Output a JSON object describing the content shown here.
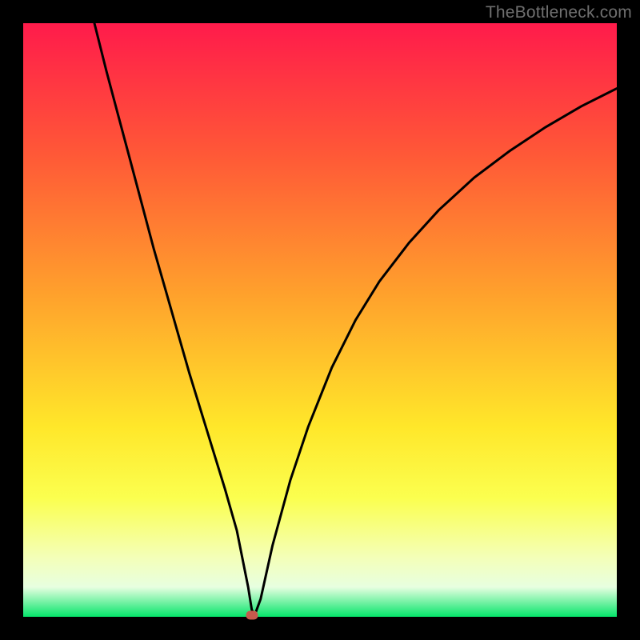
{
  "watermark": "TheBottleneck.com",
  "chart_data": {
    "type": "line",
    "title": "",
    "xlabel": "",
    "ylabel": "",
    "xlim": [
      0,
      100
    ],
    "ylim": [
      0,
      100
    ],
    "grid": false,
    "legend": false,
    "series": [
      {
        "name": "curve",
        "x": [
          12,
          14,
          16,
          18,
          20,
          22,
          24,
          26,
          28,
          30,
          32,
          34,
          36,
          37.9,
          38.5,
          39,
          40,
          42,
          45,
          48,
          52,
          56,
          60,
          65,
          70,
          76,
          82,
          88,
          94,
          100
        ],
        "values": [
          100,
          92,
          84.5,
          77,
          69.5,
          62,
          55,
          48,
          41,
          34.5,
          28,
          21.5,
          14.5,
          5,
          1.2,
          0.3,
          3,
          12,
          23,
          32,
          42,
          50,
          56.5,
          63,
          68.5,
          74,
          78.5,
          82.5,
          86,
          89
        ]
      }
    ],
    "marker": {
      "x": 38.5,
      "y": 0.3,
      "color": "#c65a4d"
    },
    "background_gradient_stops": [
      {
        "pos": 0,
        "color": "#ff1b4b"
      },
      {
        "pos": 22,
        "color": "#ff5837"
      },
      {
        "pos": 46,
        "color": "#ffa22c"
      },
      {
        "pos": 68,
        "color": "#ffe72a"
      },
      {
        "pos": 80,
        "color": "#fbff4f"
      },
      {
        "pos": 90,
        "color": "#f4ffb8"
      },
      {
        "pos": 95,
        "color": "#e7ffe0"
      },
      {
        "pos": 100,
        "color": "#05e56a"
      }
    ]
  }
}
